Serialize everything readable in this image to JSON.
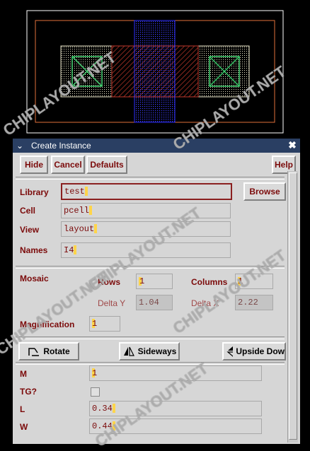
{
  "dialog": {
    "title": "Create Instance",
    "menu_glyph": "⌄",
    "close_glyph": "✖"
  },
  "toolbar": {
    "hide_label": "Hide",
    "cancel_label": "Cancel",
    "defaults_label": "Defaults",
    "help_label": "Help"
  },
  "form": {
    "library_label": "Library",
    "library_value": "test",
    "browse_label": "Browse",
    "cell_label": "Cell",
    "cell_value": "pcell",
    "view_label": "View",
    "view_value": "layout",
    "names_label": "Names",
    "names_value": "I4"
  },
  "mosaic": {
    "label": "Mosaic",
    "rows_label": "Rows",
    "rows_value": "1",
    "columns_label": "Columns",
    "columns_value": "1",
    "delta_y_label": "Delta Y",
    "delta_y_value": "1.04",
    "delta_x_label": "Delta X",
    "delta_x_value": "2.22"
  },
  "magnification": {
    "label": "Magnification",
    "value": "1"
  },
  "transform": {
    "rotate_label": "Rotate",
    "sideways_label": "Sideways",
    "upside_down_label": "Upside Dow"
  },
  "params": {
    "m_label": "M",
    "m_value": "1",
    "tg_label": "TG?",
    "l_label": "L",
    "l_value": "0.34",
    "w_label": "W",
    "w_value": "0.44"
  },
  "watermark": "CHIPLAYOUT.NET",
  "colors": {
    "label_red": "#7b0a0a",
    "titlebar": "#2a3f63",
    "dialog_bg": "#d6d6d6",
    "layout_bg": "#000000"
  }
}
